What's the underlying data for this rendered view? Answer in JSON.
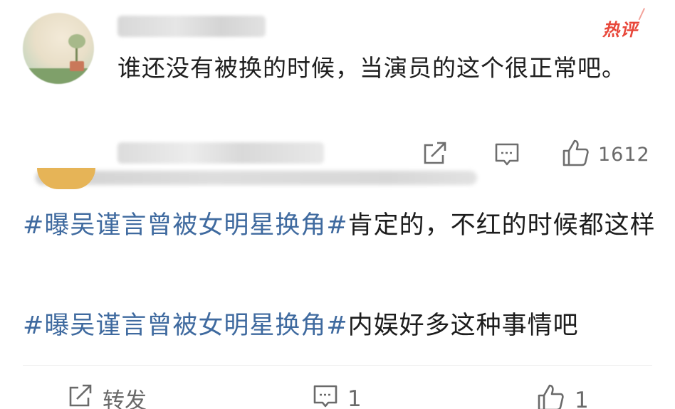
{
  "hot_badge": "热评",
  "top_comment": {
    "text": "谁还没有被换的时候，当演员的这个很正常吧。",
    "actions": {
      "share_icon": "share-icon",
      "comment_icon": "comment-icon",
      "like_icon": "thumbs-up-icon",
      "like_count": "1612"
    }
  },
  "post": {
    "paragraphs": [
      {
        "topic": "#曝吴谨言曾被女明星换角#",
        "text": "肯定的，不红的时候都这样"
      },
      {
        "topic": "#曝吴谨言曾被女明星换角#",
        "text": "内娱好多这种事情吧"
      }
    ],
    "actions": {
      "share_label": "转发",
      "comment_count": "1",
      "like_count": "1"
    }
  },
  "colors": {
    "topic_link": "#3f6a9f",
    "hot_badge": "#e8473a",
    "icon_gray": "#6e6e6e"
  }
}
